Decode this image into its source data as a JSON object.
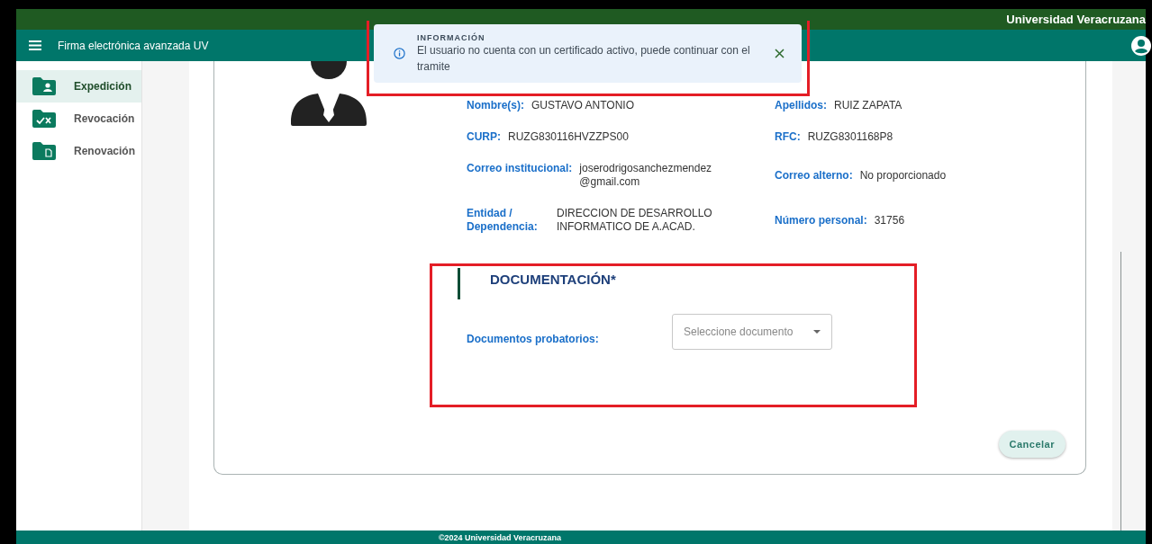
{
  "top_bar": {
    "institution": "Universidad Veracruzana"
  },
  "app_bar": {
    "title": "Firma electrónica avanzada UV"
  },
  "sidebar": {
    "items": [
      {
        "label": "Expedición",
        "selected": true,
        "kind": "person"
      },
      {
        "label": "Revocación",
        "selected": false,
        "kind": "check"
      },
      {
        "label": "Renovación",
        "selected": false,
        "kind": "document"
      }
    ]
  },
  "notification": {
    "title": "INFORMACIÓN",
    "message": "El usuario no cuenta con un certificado activo, puede continuar con el tramite"
  },
  "profile": {
    "fields": [
      {
        "label": "Nombre(s):",
        "value": "GUSTAVO ANTONIO"
      },
      {
        "label": "Apellidos:",
        "value": "RUIZ ZAPATA"
      },
      {
        "label": "CURP:",
        "value": "RUZG830116HVZZPS00"
      },
      {
        "label": "RFC:",
        "value": "RUZG8301168P8"
      },
      {
        "label": "Correo institucional:",
        "value": "joserodrigosanchezmendez\n@gmail.com"
      },
      {
        "label": "Correo alterno:",
        "value": "No proporcionado"
      },
      {
        "label": "Entidad /\nDependencia:",
        "value": "DIRECCION DE DESARROLLO\nINFORMATICO DE A.ACAD."
      },
      {
        "label": "Número personal:",
        "value": "31756"
      }
    ]
  },
  "documentation": {
    "heading": "DOCUMENTACIÓN*",
    "field_label": "Documentos probatorios:",
    "select": {
      "placeholder": "Seleccione documento"
    }
  },
  "buttons": [
    "Cancelar"
  ],
  "footer": "©2024 Universidad Veracruzana"
}
